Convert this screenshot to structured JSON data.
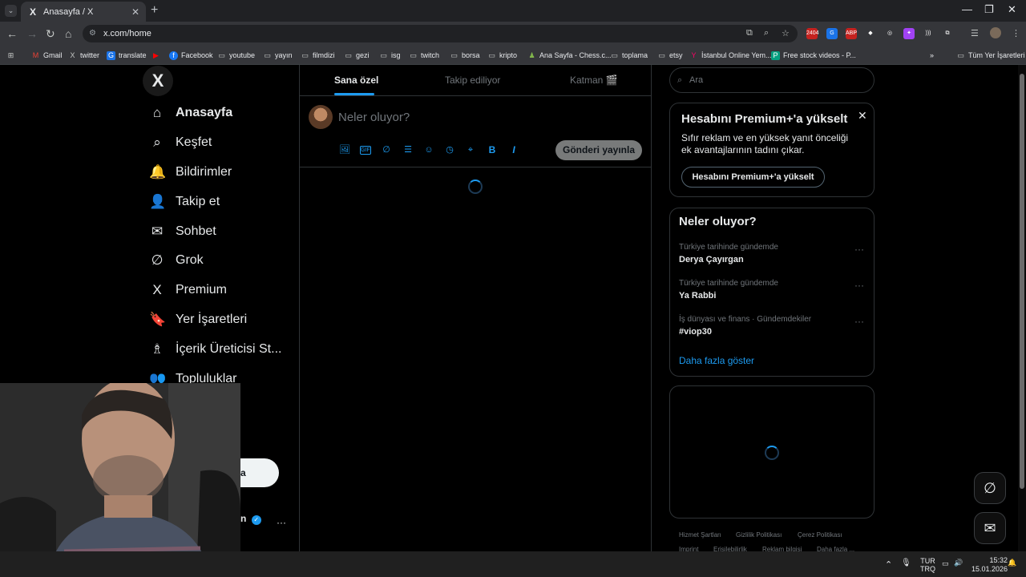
{
  "browser": {
    "tab_title": "Anasayfa / X",
    "tab_favicon": "X",
    "url": "x.com/home",
    "menu_glyph": "⌄",
    "new_tab_glyph": "+",
    "close_tab_glyph": "✕",
    "window_controls": [
      "—",
      "❐",
      "✕"
    ],
    "nav": {
      "back": "←",
      "forward": "→",
      "reload": "↻",
      "home": "⌂",
      "site_info": "⚙"
    },
    "extensions": [
      {
        "name": "adblock-extension-icon",
        "label": "2404",
        "color": "#c5221f"
      },
      {
        "name": "translate-extension-icon",
        "label": "G",
        "color": "#1a73e8"
      },
      {
        "name": "abp-extension-icon",
        "label": "ABP",
        "color": "#c5221f"
      },
      {
        "name": "diamond-extension-icon",
        "label": "◆",
        "color": "#35363a"
      },
      {
        "name": "glasses-extension-icon",
        "label": "◎",
        "color": "#35363a"
      },
      {
        "name": "puzzle-pink-extension-icon",
        "label": "✦",
        "color": "#a142f4"
      },
      {
        "name": "audio-extension-icon",
        "label": ")))",
        "color": "#35363a"
      },
      {
        "name": "extensions-puzzle-icon",
        "label": "⧉",
        "color": "#35363a"
      }
    ],
    "bookmarks": [
      {
        "label": "Gmail",
        "icon": "M"
      },
      {
        "label": "twitter",
        "icon": "X"
      },
      {
        "label": "translate",
        "icon": "G"
      },
      {
        "label": "",
        "icon": "▶"
      },
      {
        "label": "Facebook",
        "icon": "f"
      },
      {
        "label": "youtube",
        "icon": "▭"
      },
      {
        "label": "yayın",
        "icon": "▭"
      },
      {
        "label": "filmdizi",
        "icon": "▭"
      },
      {
        "label": "gezi",
        "icon": "▭"
      },
      {
        "label": "isg",
        "icon": "▭"
      },
      {
        "label": "twitch",
        "icon": "▭"
      },
      {
        "label": "borsa",
        "icon": "▭"
      },
      {
        "label": "kripto",
        "icon": "▭"
      },
      {
        "label": "Ana Sayfa - Chess.c...",
        "icon": "♟"
      },
      {
        "label": "toplama",
        "icon": "▭"
      },
      {
        "label": "etsy",
        "icon": "▭"
      },
      {
        "label": "İstanbul Online Yem...",
        "icon": "Y"
      },
      {
        "label": "Free stock videos - P...",
        "icon": "P"
      }
    ],
    "bookmarks_overflow": "»",
    "all_bookmarks": "Tüm Yer İşaretleri"
  },
  "sidebar": {
    "logo": "X",
    "items": [
      {
        "label": "Anasayfa",
        "icon": "⌂"
      },
      {
        "label": "Keşfet",
        "icon": "⌕"
      },
      {
        "label": "Bildirimler",
        "icon": "🔔"
      },
      {
        "label": "Takip et",
        "icon": "👤"
      },
      {
        "label": "Sohbet",
        "icon": "✉"
      },
      {
        "label": "Grok",
        "icon": "∅"
      },
      {
        "label": "Premium",
        "icon": "X"
      },
      {
        "label": "Yer İşaretleri",
        "icon": "🔖"
      },
      {
        "label": "İçerik Üreticisi St...",
        "icon": "♗"
      },
      {
        "label": "Topluluklar",
        "icon": "👥"
      }
    ],
    "post_button_fragment": "a",
    "profile_name_fragment": "n",
    "profile_more": "···"
  },
  "feed": {
    "tabs": [
      "Sana özel",
      "Takip ediliyor",
      "Katman 🎬"
    ],
    "compose_placeholder": "Neler oluyor?",
    "compose_icons": [
      "🖼",
      "GIF",
      "∅",
      "☰",
      "☺",
      "◷",
      "⌖",
      "B",
      "I"
    ],
    "post_button": "Gönderi yayınla"
  },
  "right": {
    "search_placeholder": "Ara",
    "premium": {
      "title": "Hesabını Premium+'a yükselt",
      "desc": "Sıfır reklam ve en yüksek yanıt önceliği ek avantajlarının tadını çıkar.",
      "button": "Hesabını Premium+'a yükselt",
      "close": "✕"
    },
    "trends": {
      "title": "Neler oluyor?",
      "items": [
        {
          "context": "Türkiye tarihinde gündemde",
          "name": "Derya Çayırgan"
        },
        {
          "context": "Türkiye tarihinde gündemde",
          "name": "Ya Rabbi"
        },
        {
          "context": "İş dünyası ve finans · Gündemdekiler",
          "name": "#viop30"
        }
      ],
      "more_glyph": "···",
      "show_more": "Daha fazla göster"
    },
    "footer": [
      "Hizmet Şartları",
      "Gizlilik Politikası",
      "Çerez Politikası",
      "Imprint",
      "Erişilebilirlik",
      "Reklam bilgisi",
      "Daha fazla ..."
    ],
    "fab_grok": "∅",
    "fab_messages": "✉"
  },
  "taskbar": {
    "lang": "TUR",
    "layout": "TRQ",
    "time": "15:32",
    "date": "15.01.2026",
    "tray_up": "⌃",
    "mic": "🎙",
    "network": "▭",
    "volume": "🔊",
    "notification": "🔔"
  }
}
